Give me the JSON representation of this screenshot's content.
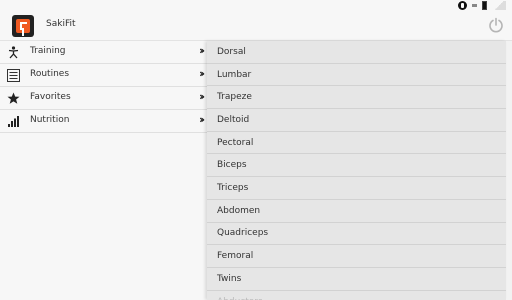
{
  "app": {
    "title": "SakiFit"
  },
  "nav": [
    {
      "label": "Training",
      "icon": "training-icon"
    },
    {
      "label": "Routines",
      "icon": "routines-icon"
    },
    {
      "label": "Favorites",
      "icon": "star-icon"
    },
    {
      "label": "Nutrition",
      "icon": "bars-icon"
    }
  ],
  "muscles": [
    "Dorsal",
    "Lumbar",
    "Trapeze",
    "Deltoid",
    "Pectoral",
    "Biceps",
    "Triceps",
    "Abdomen",
    "Quadriceps",
    "Femoral",
    "Twins",
    "Abductors"
  ],
  "colors": {
    "accent": "#f05a22"
  }
}
